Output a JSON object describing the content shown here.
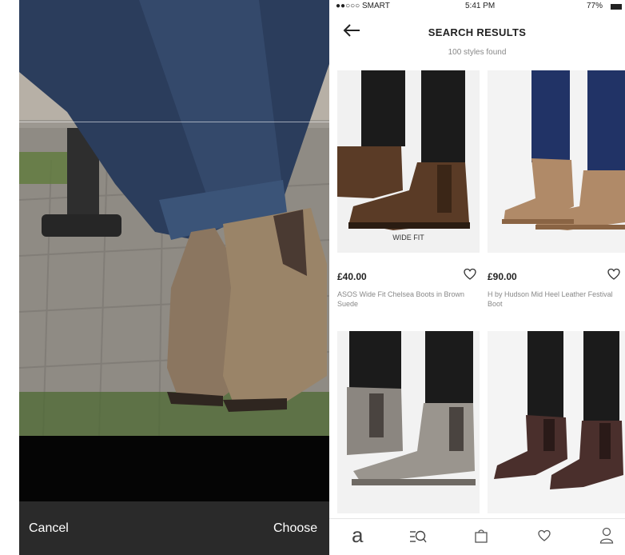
{
  "crop_screen": {
    "cancel_label": "Cancel",
    "choose_label": "Choose"
  },
  "status_bar": {
    "carrier": "●●○○○ SMART",
    "time": "5:41 PM",
    "battery": "77%"
  },
  "header": {
    "title": "SEARCH RESULTS",
    "subtitle": "100 styles found",
    "back_icon": "arrow-left-icon"
  },
  "products": [
    {
      "badge": "WIDE FIT",
      "price": "£40.00",
      "name": "ASOS Wide Fit Chelsea Boots in Brown Suede",
      "color": "#5a3b26"
    },
    {
      "badge": "",
      "price": "£90.00",
      "name": "H by Hudson Mid Heel Leather Festival Boot",
      "color": "#b08a68"
    },
    {
      "badge": "",
      "price": "",
      "name": "",
      "color": "#8b8680"
    },
    {
      "badge": "",
      "price": "",
      "name": "",
      "color": "#4a2f2c"
    }
  ],
  "tab_bar": {
    "items": [
      "home-logo-icon",
      "search-filter-icon",
      "bag-icon",
      "saved-heart-icon",
      "account-icon"
    ]
  }
}
